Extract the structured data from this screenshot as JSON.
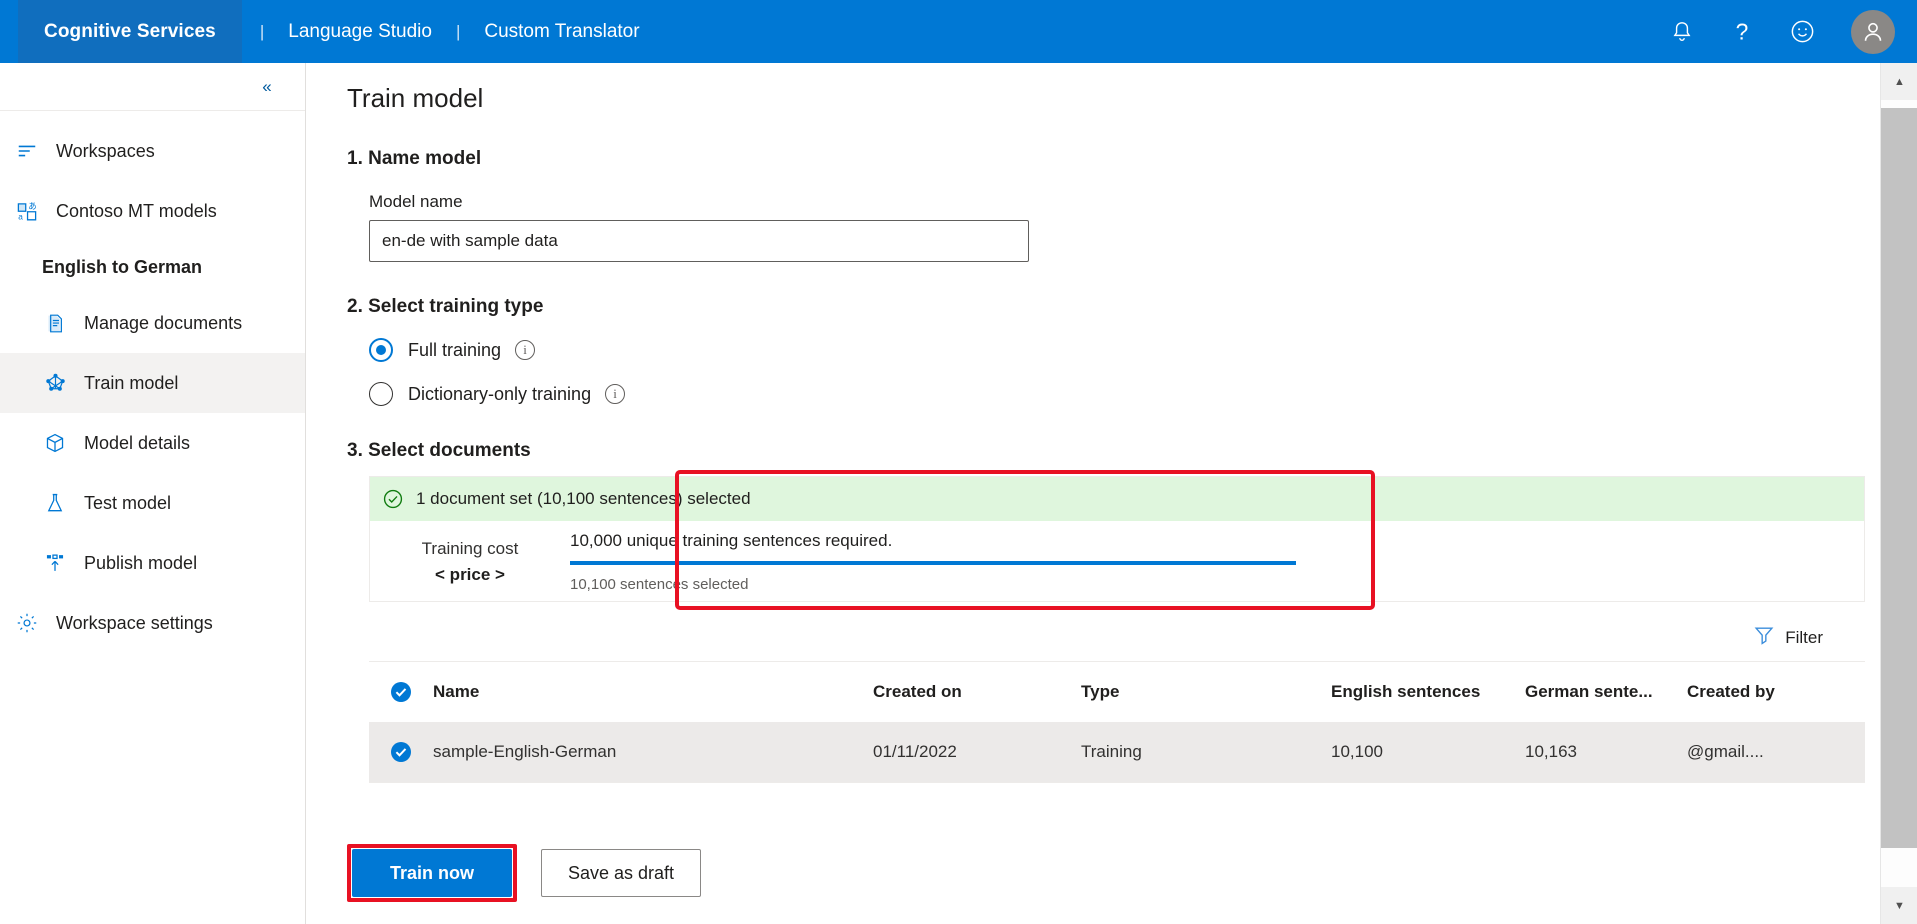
{
  "header": {
    "brand": "Cognitive Services",
    "separator": "|",
    "nav": [
      {
        "label": "Language Studio"
      },
      {
        "label": "Custom Translator"
      }
    ],
    "icons": [
      {
        "name": "notification-bell-icon"
      },
      {
        "name": "help-question-icon"
      },
      {
        "name": "feedback-smiley-icon"
      },
      {
        "name": "user-avatar-icon"
      }
    ],
    "accent_color": "#0078d4",
    "brand_block_color": "#106ebe"
  },
  "sidebar": {
    "collapse_label": "«",
    "items": [
      {
        "label": "Workspaces",
        "icon": "workspaces-icon",
        "type": "top",
        "selected": false
      },
      {
        "label": "Contoso MT models",
        "icon": "translate-models-icon",
        "type": "top",
        "selected": false
      },
      {
        "label": "English to German",
        "icon": "",
        "type": "section",
        "selected": false
      },
      {
        "label": "Manage documents",
        "icon": "documents-icon",
        "type": "sub",
        "selected": false
      },
      {
        "label": "Train model",
        "icon": "train-model-icon",
        "type": "sub",
        "selected": true
      },
      {
        "label": "Model details",
        "icon": "model-details-icon",
        "type": "sub",
        "selected": false
      },
      {
        "label": "Test model",
        "icon": "test-flask-icon",
        "type": "sub",
        "selected": false
      },
      {
        "label": "Publish model",
        "icon": "publish-upload-icon",
        "type": "sub",
        "selected": false
      },
      {
        "label": "Workspace settings",
        "icon": "gear-icon",
        "type": "top",
        "selected": false
      }
    ]
  },
  "main": {
    "page_title": "Train model",
    "step1": {
      "heading": "1. Name model",
      "field_label": "Model name",
      "model_name_value": "en-de with sample data",
      "model_name_placeholder": "Model name"
    },
    "step2": {
      "heading": "2. Select training type",
      "options": [
        {
          "label": "Full training",
          "selected": true,
          "info": "i"
        },
        {
          "label": "Dictionary-only training",
          "selected": false,
          "info": "i"
        }
      ]
    },
    "step3": {
      "heading": "3. Select documents",
      "banner_text": "1 document set (10,100 sentences) selected",
      "banner_color": "#dff6dd",
      "cost_title": "Training cost",
      "cost_value": "< price >",
      "meter_title": "10,000 unique training sentences required.",
      "meter_sub": "10,100 sentences selected",
      "meter_percent": 100,
      "meter_color": "#0078d4",
      "highlight_color": "#e81123"
    },
    "filter": {
      "label": "Filter",
      "icon": "filter-funnel-icon"
    },
    "table": {
      "columns": [
        "Name",
        "Created on",
        "Type",
        "English sentences",
        "German sente...",
        "Created by"
      ],
      "rows": [
        {
          "selected": true,
          "name": "sample-English-German",
          "created_on": "01/11/2022",
          "type": "Training",
          "english_sentences": "10,100",
          "german_sentences": "10,163",
          "created_by": "@gmail...."
        }
      ]
    },
    "actions": {
      "primary": "Train now",
      "secondary": "Save as draft"
    }
  },
  "scrollbar": {
    "up": "▲",
    "down": "▼"
  }
}
